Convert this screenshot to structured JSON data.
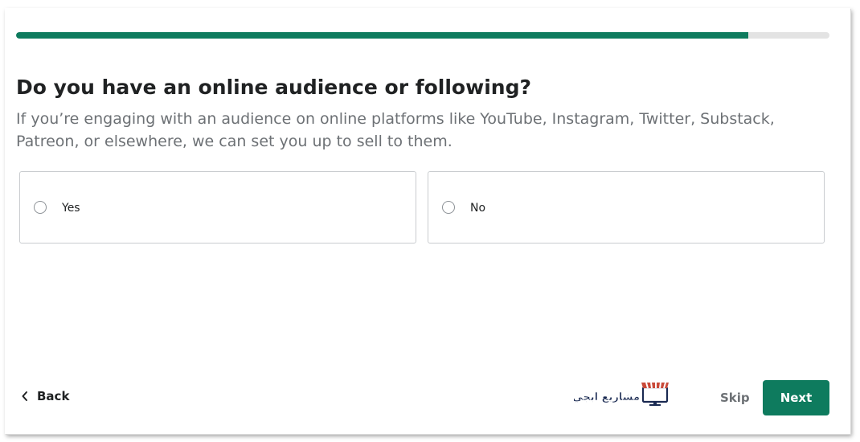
{
  "progress": {
    "value": 0.9,
    "color": "#0e7b5e",
    "track_color": "#e3e3e3"
  },
  "question": {
    "title": "Do you have an online audience or following?",
    "subtitle": "If you’re engaging with an audience on online platforms like YouTube, Instagram, Twitter, Substack, Patreon, or elsewhere, we can set you up to sell to them."
  },
  "options": [
    {
      "label": "Yes",
      "selected": false
    },
    {
      "label": "No",
      "selected": false
    }
  ],
  "footer": {
    "back_label": "Back",
    "back_icon": "chevron-left-icon",
    "skip_label": "Skip",
    "next_label": "Next",
    "accent": "#0e7b5e"
  },
  "watermark": {
    "text": "مشاريع ابجي",
    "icon": "storefront-monitor-icon"
  }
}
